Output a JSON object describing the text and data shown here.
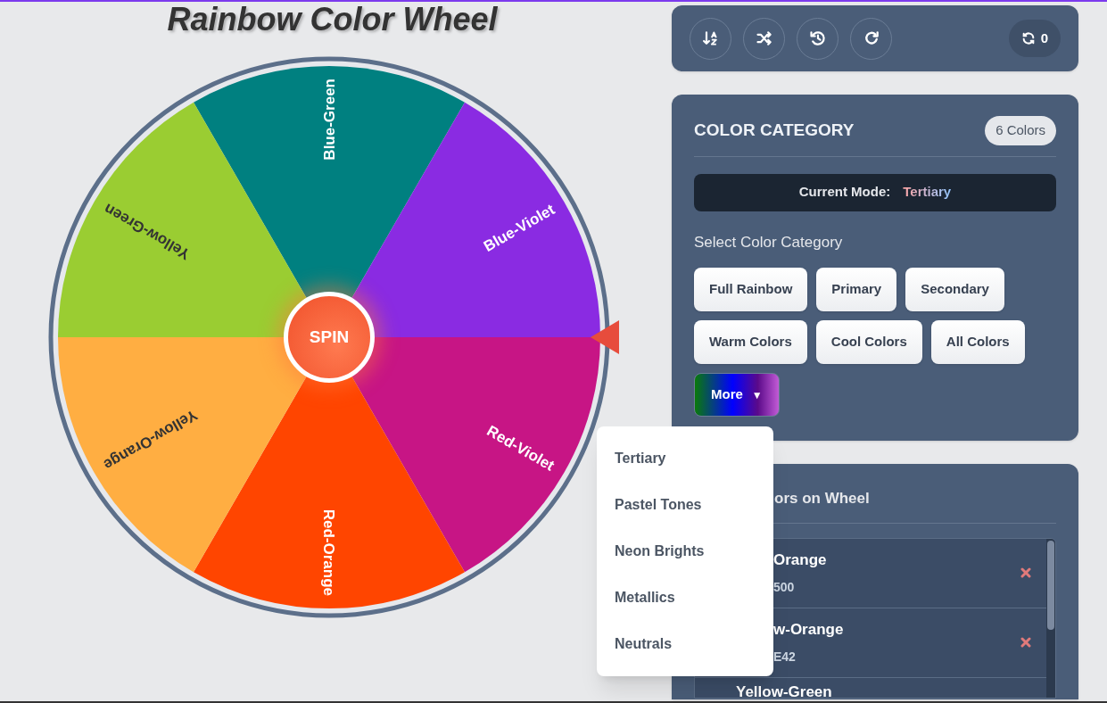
{
  "title": "Rainbow Color Wheel",
  "wheel": {
    "segments": [
      {
        "label": "Blue-Green",
        "color": "#008080"
      },
      {
        "label": "Blue-Violet",
        "color": "#8a2be2"
      },
      {
        "label": "Red-Violet",
        "color": "#c71585"
      },
      {
        "label": "Red-Orange",
        "color": "#ff4500"
      },
      {
        "label": "Yellow-Orange",
        "color": "#ffae42"
      },
      {
        "label": "Yellow-Green",
        "color": "#9acd32"
      }
    ],
    "spin_button": "SPIN"
  },
  "toolbar": {
    "buttons": [
      {
        "kind": "sort"
      },
      {
        "kind": "shuffle"
      },
      {
        "kind": "history"
      },
      {
        "kind": "redo"
      }
    ],
    "spin_count": "0"
  },
  "category_panel": {
    "title": "COLOR CATEGORY",
    "badge": "6 Colors",
    "mode_label": "Current Mode:",
    "mode_value": "Tertiary",
    "select_label": "Select Color Category",
    "buttons": [
      "Full Rainbow",
      "Primary",
      "Secondary",
      "Warm Colors",
      "Cool Colors",
      "All Colors"
    ],
    "more_button": {
      "label": "More",
      "caret": "▼"
    }
  },
  "more_menu": {
    "items": [
      "Tertiary",
      "Pastel Tones",
      "Neon Brights",
      "Metallics",
      "Neutrals"
    ]
  },
  "colors_panel": {
    "title": "ors on Wheel",
    "items": [
      {
        "name": "Orange",
        "hex": "500"
      },
      {
        "name": "w-Orange",
        "hex": "E42"
      },
      {
        "name": "Yellow-Green"
      }
    ]
  }
}
